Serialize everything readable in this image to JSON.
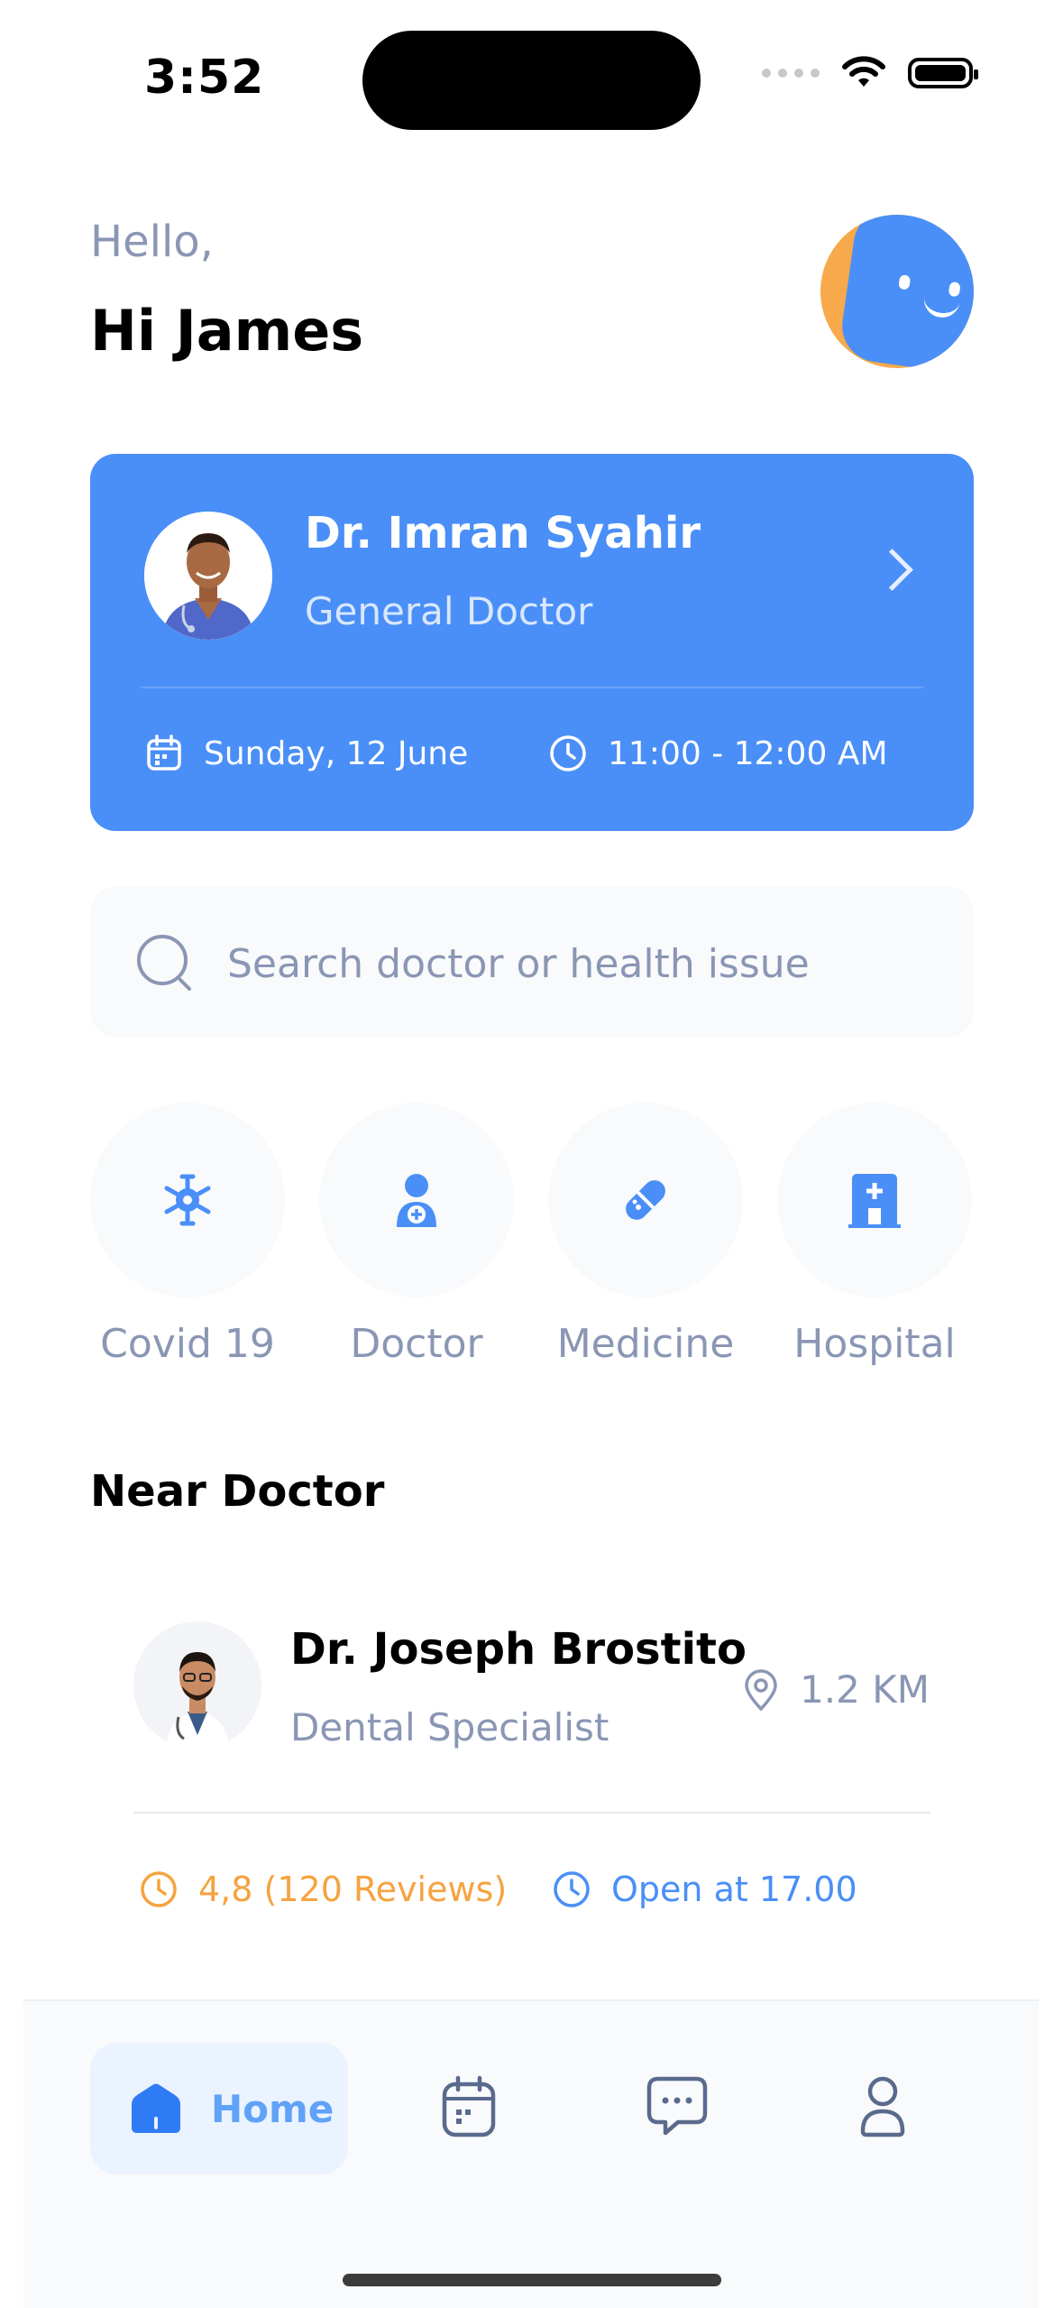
{
  "status_bar": {
    "time": "3:52"
  },
  "header": {
    "greeting": "Hello,",
    "name": "Hi  James"
  },
  "appointment": {
    "doctor_name": "Dr. Imran Syahir",
    "doctor_role": "General Doctor",
    "date": "Sunday, 12 June",
    "time": "11:00 - 12:00 AM"
  },
  "search": {
    "placeholder": "Search doctor or health issue"
  },
  "categories": [
    {
      "label": "Covid 19",
      "icon": "virus-icon"
    },
    {
      "label": "Doctor",
      "icon": "doctor-icon"
    },
    {
      "label": "Medicine",
      "icon": "pill-icon"
    },
    {
      "label": "Hospital",
      "icon": "hospital-icon"
    }
  ],
  "near_doctor": {
    "title": "Near Doctor",
    "doctor": {
      "name": "Dr. Joseph Brostito",
      "specialty": "Dental Specialist",
      "distance": "1.2 KM",
      "rating": "4,8 (120 Reviews)",
      "open": "Open at 17.00"
    }
  },
  "nav": {
    "home_label": "Home",
    "items": [
      "home-icon",
      "calendar-icon",
      "chat-icon",
      "profile-icon"
    ]
  },
  "colors": {
    "primary": "#4a8ff7",
    "muted": "#8a96b4",
    "rating": "#f5a340"
  }
}
